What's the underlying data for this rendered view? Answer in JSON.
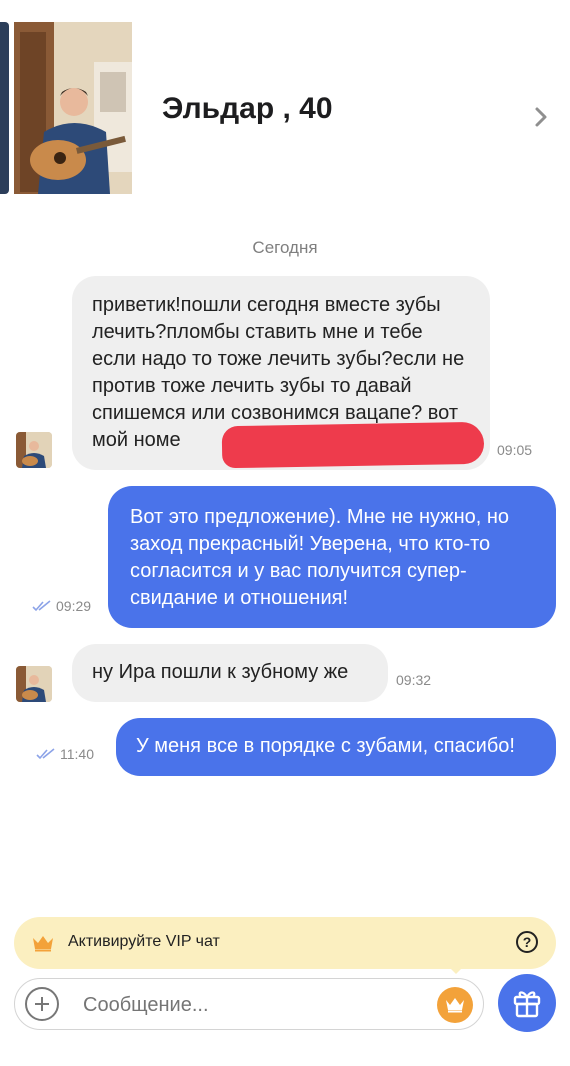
{
  "header": {
    "name": "Эльдар , 40"
  },
  "date_separator": "Сегодня",
  "messages": [
    {
      "dir": "in",
      "text": "приветик!пошли сегодня вместе зубы лечить?пломбы ставить мне и тебе если надо то тоже лечить зубы?если не против тоже лечить зубы то давай спишемся или созвонимся вацапе? вот мой номе",
      "time": "09:05"
    },
    {
      "dir": "out",
      "text": "Вот это предложение). Мне не нужно, но заход прекрасный! Уверена, что кто-то согласится и у вас получится супер-свидание и отношения!",
      "time": "09:29"
    },
    {
      "dir": "in",
      "text": "ну Ира пошли к зубному же",
      "time": "09:32"
    },
    {
      "dir": "out",
      "text": "У меня все в порядке с зубами, спасибо!",
      "time": "11:40"
    }
  ],
  "vip": {
    "label": "Активируйте VIP чат",
    "help": "?"
  },
  "composer": {
    "placeholder": "Сообщение..."
  },
  "colors": {
    "accent": "#4a73ea",
    "incoming_bubble": "#efefef",
    "vip_bg": "#fbefc0",
    "crown": "#f3a23a",
    "redaction": "#ee3b4c"
  },
  "icons": [
    "chevron-right-icon",
    "read-checkmarks-icon",
    "crown-icon",
    "help-icon",
    "plus-icon",
    "gift-icon"
  ]
}
